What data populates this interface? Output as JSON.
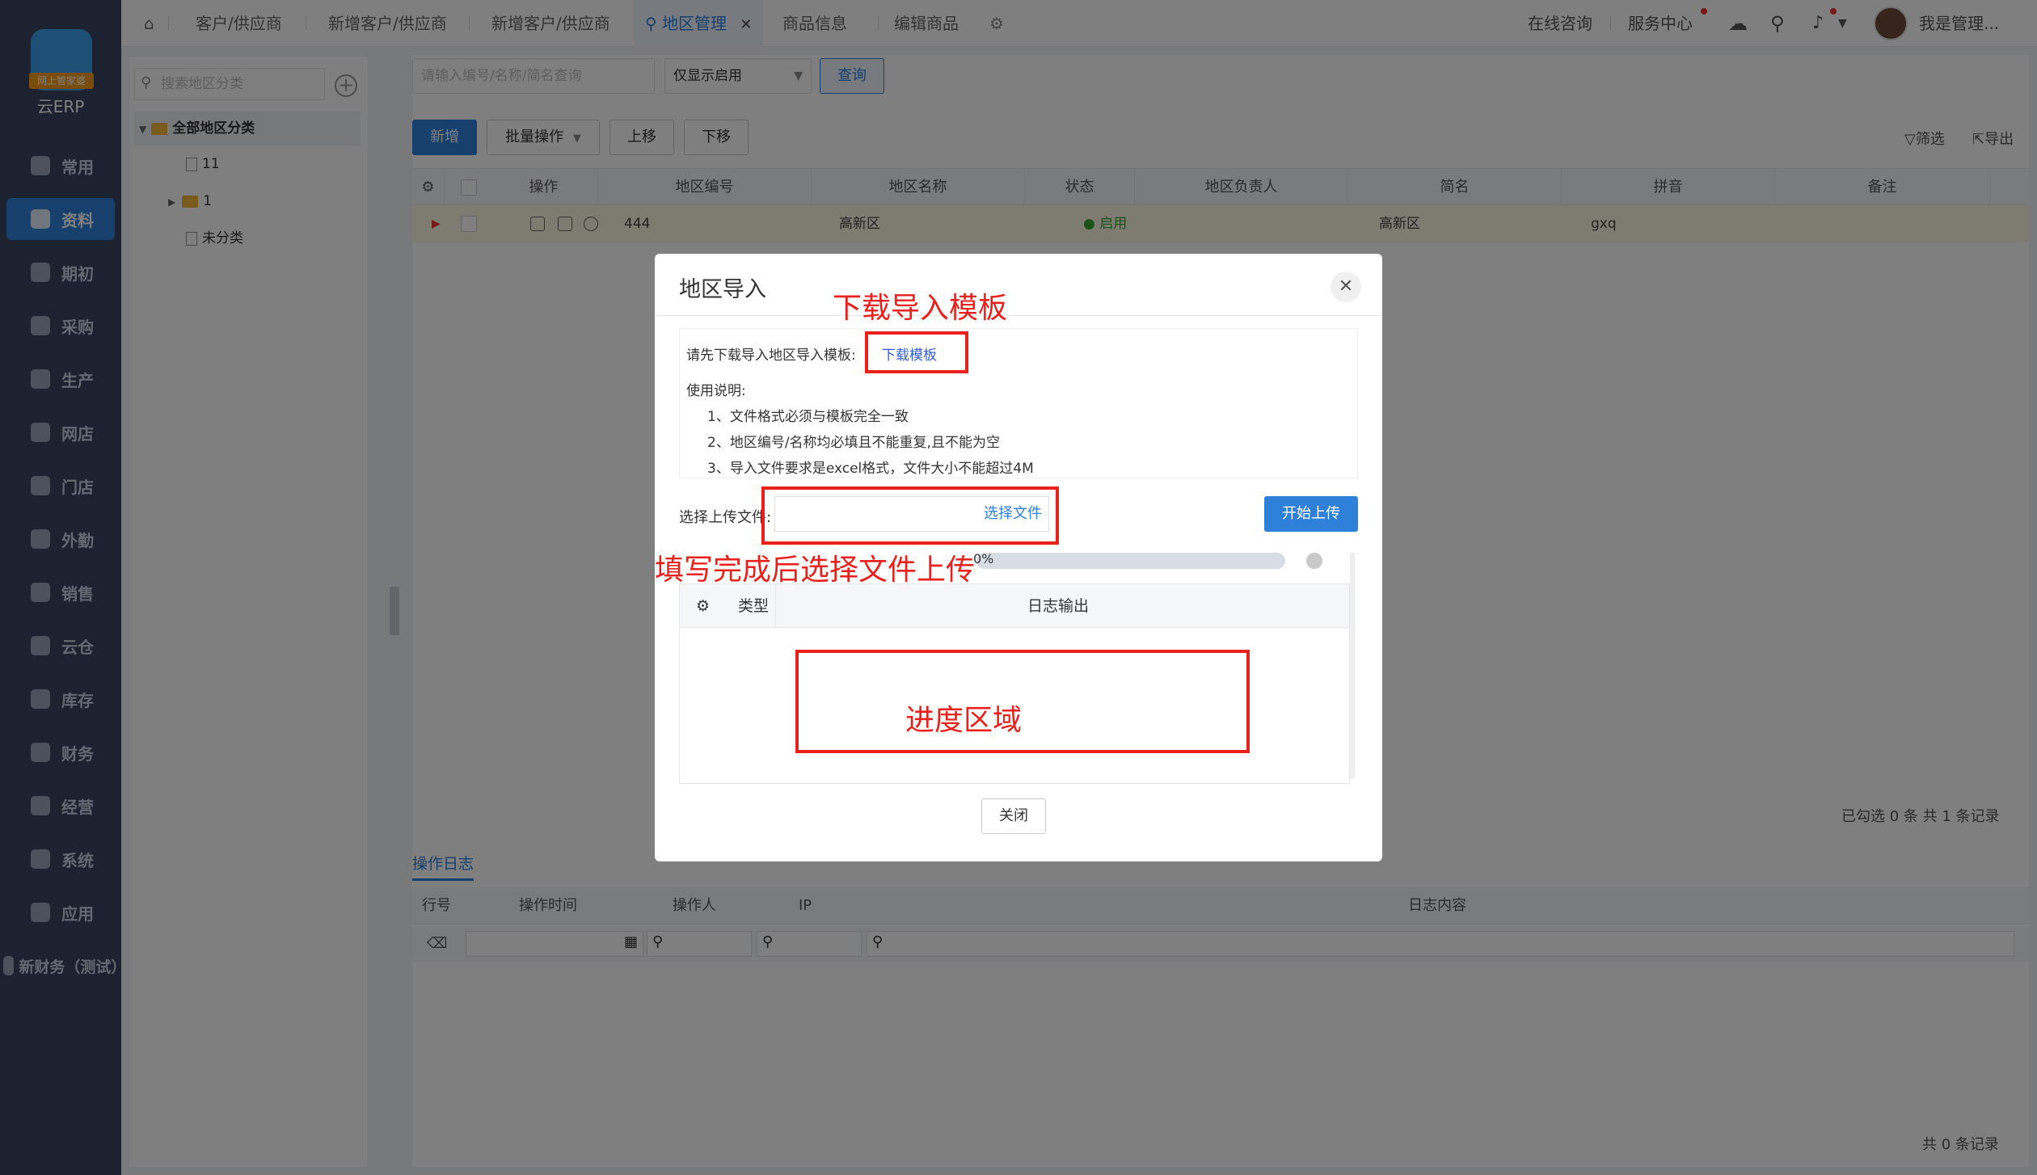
{
  "sidebar": {
    "logo_badge": "网上管家婆",
    "logo_text": "云ERP",
    "items": [
      {
        "label": "常用"
      },
      {
        "label": "资料"
      },
      {
        "label": "期初"
      },
      {
        "label": "采购"
      },
      {
        "label": "生产"
      },
      {
        "label": "网店"
      },
      {
        "label": "门店"
      },
      {
        "label": "外勤"
      },
      {
        "label": "销售"
      },
      {
        "label": "云仓"
      },
      {
        "label": "库存"
      },
      {
        "label": "财务"
      },
      {
        "label": "经营"
      },
      {
        "label": "系统"
      },
      {
        "label": "应用"
      },
      {
        "label": "新财务（测试）"
      }
    ],
    "active_index": 1
  },
  "topbar": {
    "tabs": [
      {
        "label": "客户/供应商"
      },
      {
        "label": "新增客户/供应商"
      },
      {
        "label": "新增客户/供应商"
      },
      {
        "label": "地区管理"
      },
      {
        "label": "商品信息"
      },
      {
        "label": "编辑商品"
      }
    ],
    "active_tab_index": 3,
    "close_glyph": "✕",
    "online_consult": "在线咨询",
    "service_center": "服务中心",
    "user_name": "我是管理..."
  },
  "tree": {
    "search_placeholder": "搜索地区分类",
    "plus": "+",
    "root": "全部地区分类",
    "nodes": [
      {
        "label": "11"
      },
      {
        "label": "1"
      },
      {
        "label": "未分类"
      }
    ]
  },
  "toolbar": {
    "search_placeholder": "请输入编号/名称/简名查询",
    "filter_select": "仅显示启用",
    "query": "查询",
    "add": "新增",
    "batch": "批量操作",
    "move_up": "上移",
    "move_down": "下移",
    "filter": "筛选",
    "export": "导出"
  },
  "grid": {
    "columns": [
      "操作",
      "地区编号",
      "地区名称",
      "状态",
      "地区负责人",
      "简名",
      "拼音",
      "备注"
    ],
    "rows": [
      {
        "code": "444",
        "name": "高新区",
        "status": "启用",
        "manager": "",
        "short": "高新区",
        "pinyin": "gxq",
        "note": ""
      }
    ],
    "record_info": "已勾选 0 条  共 1 条记录"
  },
  "log": {
    "tab": "操作日志",
    "columns": [
      "行号",
      "操作时间",
      "操作人",
      "IP",
      "日志内容"
    ],
    "record_info": "共 0 条记录"
  },
  "modal": {
    "title": "地区导入",
    "close_glyph": "✕",
    "download_prompt": "请先下载导入地区导入模板:",
    "download_link": "下载模板",
    "usage_title": "使用说明:",
    "usage_lines": [
      "1、文件格式必须与模板完全一致",
      "2、地区编号/名称均必填且不能重复,且不能为空",
      "3、导入文件要求是excel格式，文件大小不能超过4M"
    ],
    "upload_label": "选择上传文件:",
    "choose_file": "选择文件",
    "start_upload": "开始上传",
    "progress_text": "0%",
    "progress_value": 0,
    "log_columns": [
      "类型",
      "日志输出"
    ],
    "close": "关闭"
  },
  "annotations": {
    "download_template": "下载导入模板",
    "upload_hint": "填写完成后选择文件上传",
    "progress_area": "进度区域",
    "color": "#e8211c"
  }
}
